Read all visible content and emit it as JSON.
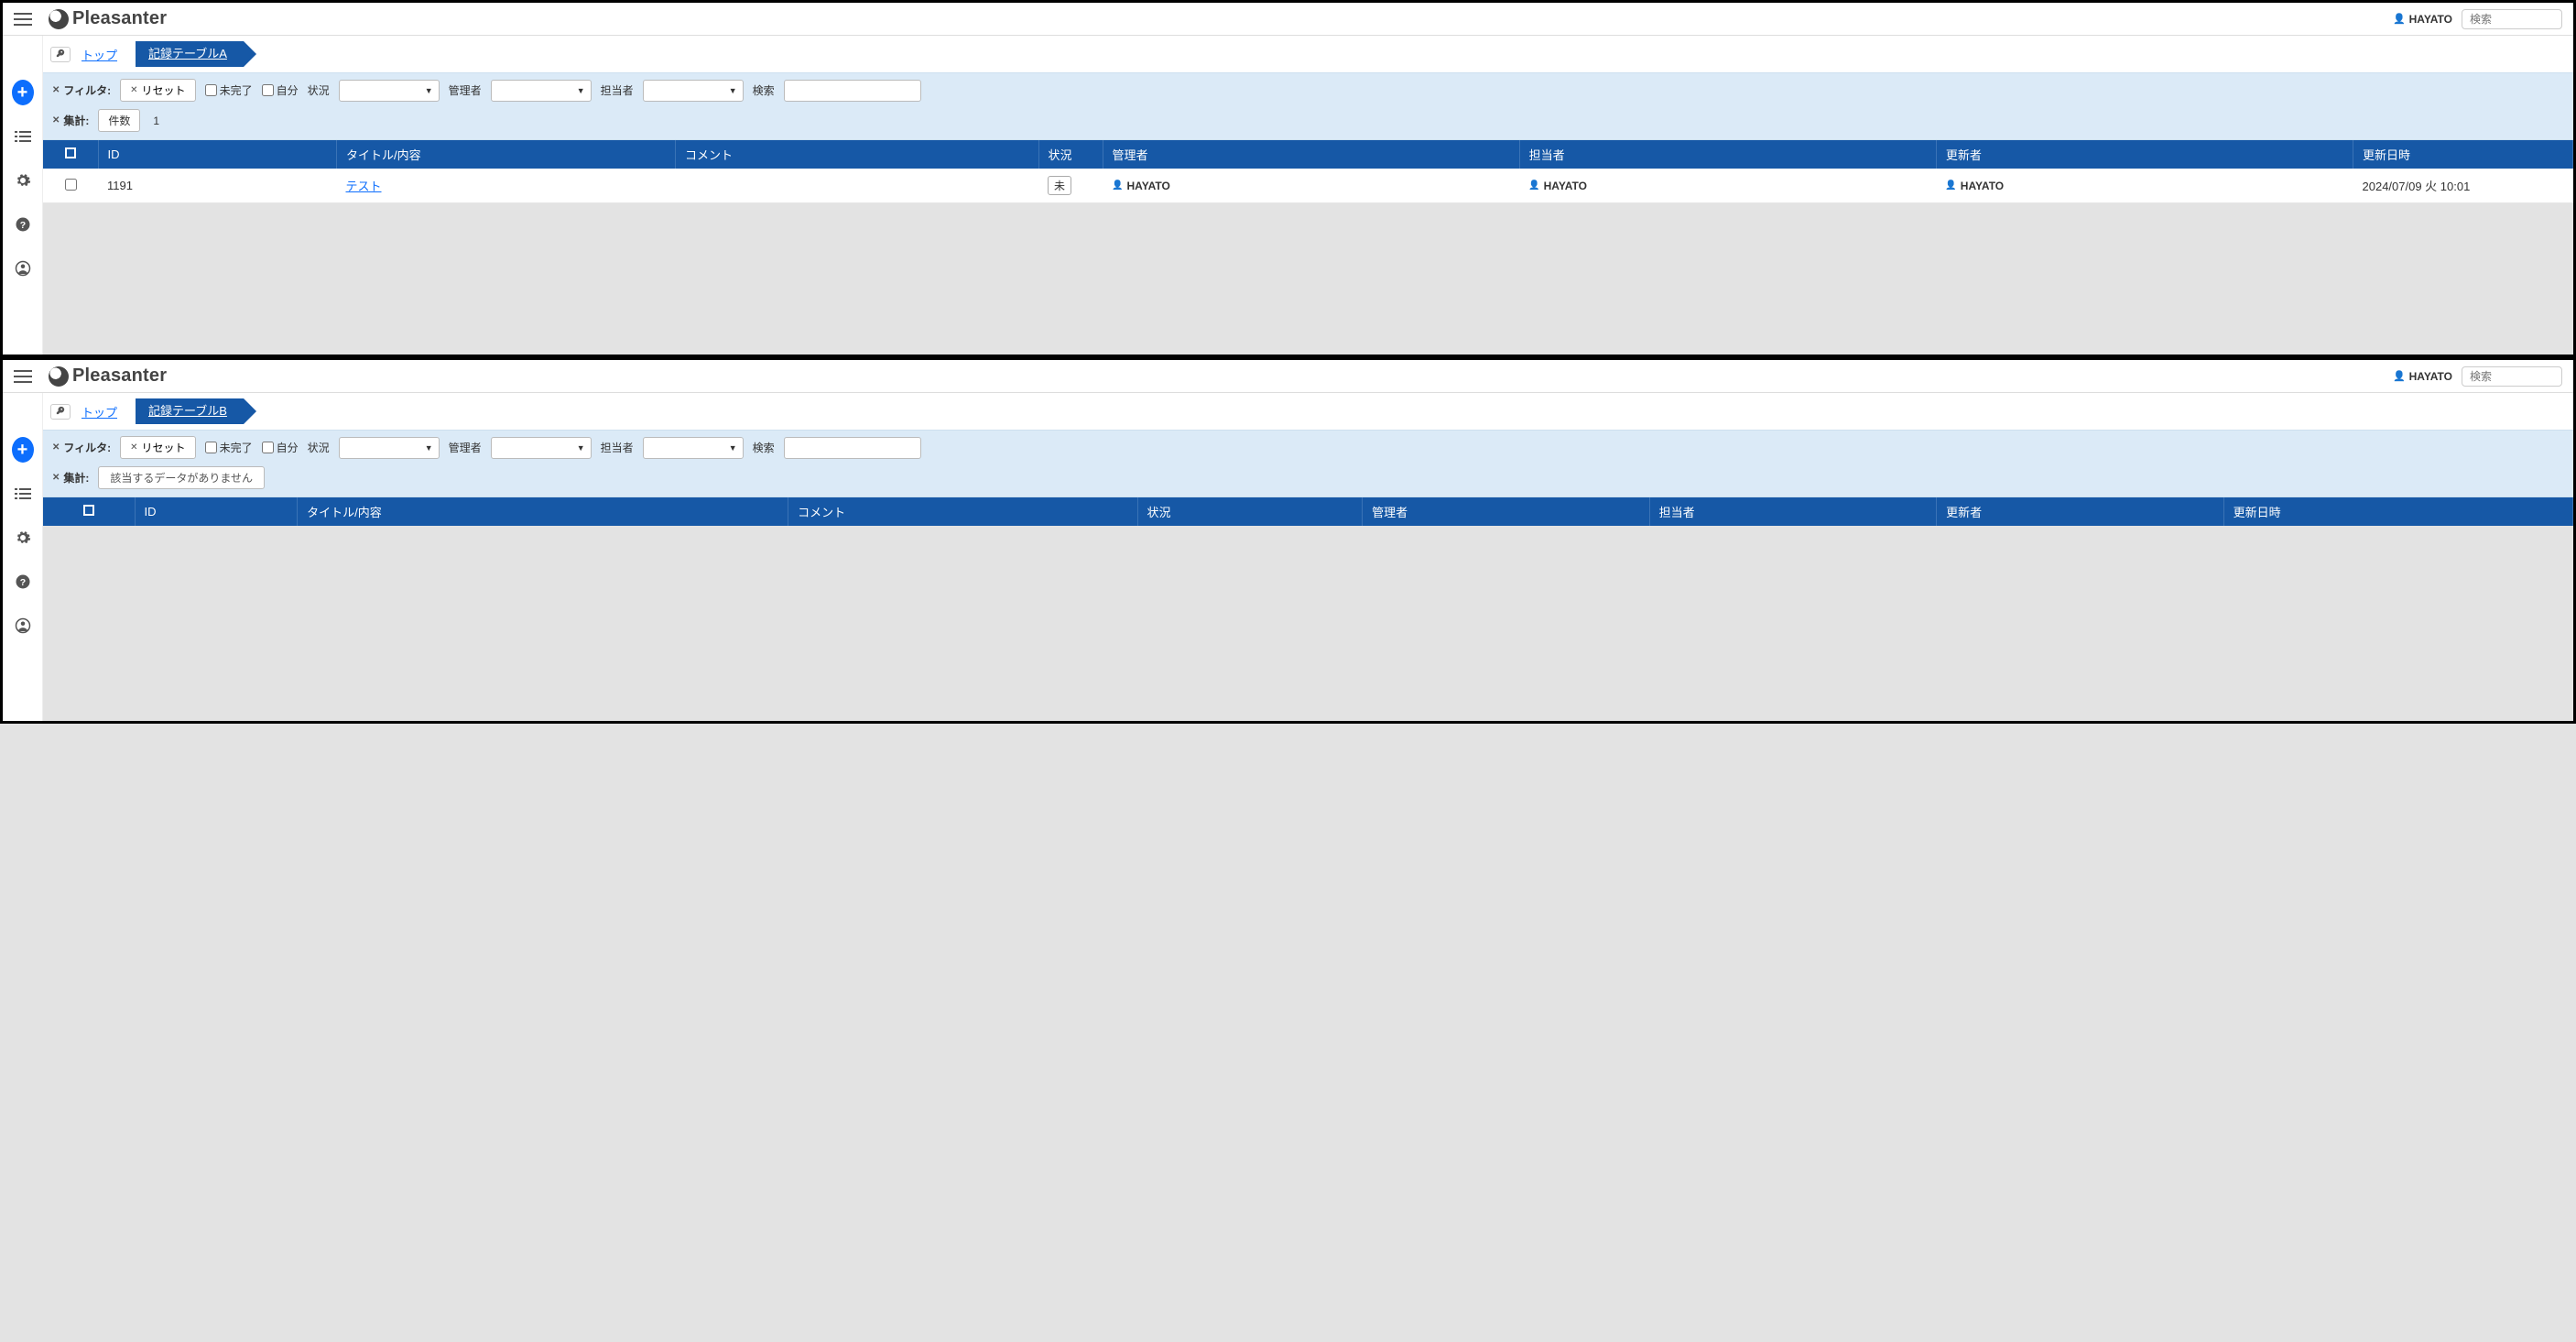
{
  "brand": "Pleasanter",
  "user": "HAYATO",
  "search_placeholder": "検索",
  "crumbs": {
    "top": "トップ"
  },
  "filter": {
    "label": "フィルタ:",
    "reset": "リセット",
    "incomplete": "未完了",
    "self": "自分",
    "status": "状況",
    "manager": "管理者",
    "owner": "担当者",
    "search": "検索"
  },
  "aggregate": {
    "label": "集計:",
    "count_label": "件数",
    "empty_msg": "該当するデータがありません"
  },
  "columns": {
    "id": "ID",
    "title": "タイトル/内容",
    "comment": "コメント",
    "status": "状況",
    "manager": "管理者",
    "owner": "担当者",
    "updater": "更新者",
    "updated": "更新日時"
  },
  "panels": [
    {
      "key": "A",
      "crumb": "記録テーブルA",
      "count": "1",
      "rows": [
        {
          "id": "1191",
          "title": "テスト",
          "comment": "",
          "status": "未",
          "manager": "HAYATO",
          "owner": "HAYATO",
          "updater": "HAYATO",
          "updated": "2024/07/09 火 10:01"
        }
      ]
    },
    {
      "key": "B",
      "crumb": "記録テーブルB",
      "count": null,
      "rows": []
    }
  ]
}
